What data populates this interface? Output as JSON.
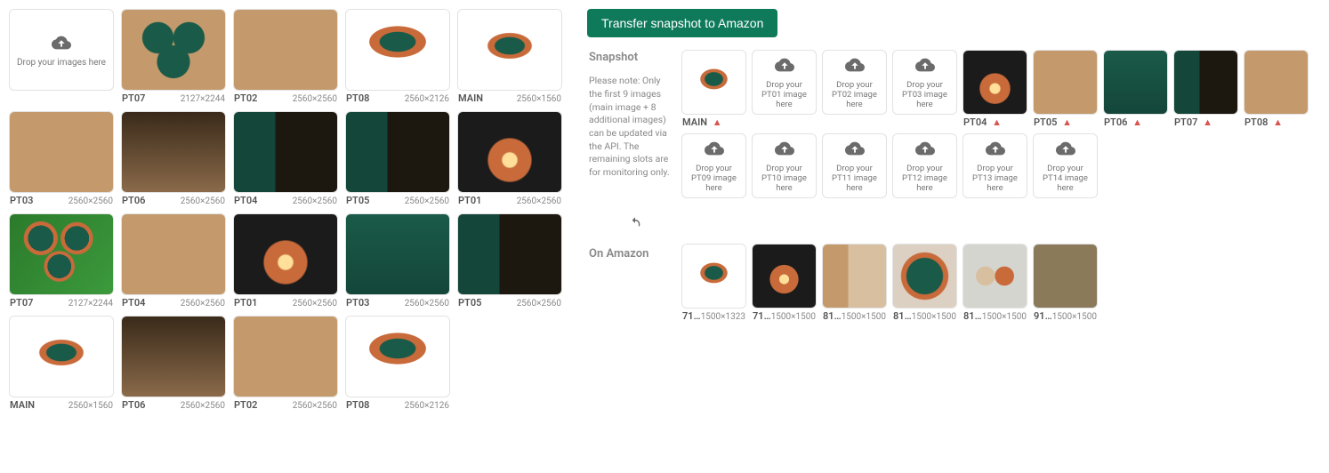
{
  "transfer_button": "Transfer snapshot to Amazon",
  "snapshot": {
    "title": "Snapshot",
    "note": "Please note: Only the first 9 images (main image + 8 additional images) can be updated via the API. The remaining slots are for monitoring only."
  },
  "left_drop_label": "Drop your images here",
  "left_images": [
    {
      "label": "PT07",
      "dim": "2127×2244",
      "variant": "green3"
    },
    {
      "label": "PT02",
      "dim": "2560×2560",
      "variant": "tan"
    },
    {
      "label": "PT08",
      "dim": "2560×2126",
      "variant": "bowl"
    },
    {
      "label": "MAIN",
      "dim": "2560×1560",
      "variant": "main"
    },
    {
      "label": "PT03",
      "dim": "2560×2560",
      "variant": "tan"
    },
    {
      "label": "PT06",
      "dim": "2560×2560",
      "variant": "people"
    },
    {
      "label": "PT04",
      "dim": "2560×2560",
      "variant": "night"
    },
    {
      "label": "PT05",
      "dim": "2560×2560",
      "variant": "night"
    },
    {
      "label": "PT01",
      "dim": "2560×2560",
      "variant": "dark"
    },
    {
      "label": "PT07",
      "dim": "2127×2244",
      "variant": "grass"
    },
    {
      "label": "PT04",
      "dim": "2560×2560",
      "variant": "tan"
    },
    {
      "label": "PT01",
      "dim": "2560×2560",
      "variant": "dark"
    },
    {
      "label": "PT03",
      "dim": "2560×2560",
      "variant": "teal"
    },
    {
      "label": "PT05",
      "dim": "2560×2560",
      "variant": "night"
    },
    {
      "label": "MAIN",
      "dim": "2560×1560",
      "variant": "main"
    },
    {
      "label": "PT06",
      "dim": "2560×2560",
      "variant": "people"
    },
    {
      "label": "PT02",
      "dim": "2560×2560",
      "variant": "tan"
    },
    {
      "label": "PT08",
      "dim": "2560×2126",
      "variant": "bowl"
    }
  ],
  "snapshot_slots": [
    {
      "label": "MAIN",
      "warn": true,
      "image": "main",
      "drop_text": ""
    },
    {
      "label": "",
      "drop_text": "Drop your PT01 image here"
    },
    {
      "label": "",
      "drop_text": "Drop your PT02 image here"
    },
    {
      "label": "",
      "drop_text": "Drop your PT03 image here"
    },
    {
      "label": "PT04",
      "warn": true,
      "image": "dark",
      "drop_text": ""
    },
    {
      "label": "PT05",
      "warn": true,
      "image": "tan",
      "drop_text": ""
    },
    {
      "label": "PT06",
      "warn": true,
      "image": "teal",
      "drop_text": ""
    },
    {
      "label": "PT07",
      "warn": true,
      "image": "night",
      "drop_text": ""
    },
    {
      "label": "PT08",
      "warn": true,
      "image": "tan",
      "drop_text": ""
    },
    {
      "label": "",
      "drop_text": "Drop your PT09 image here"
    },
    {
      "label": "",
      "drop_text": "Drop your PT10 image here"
    },
    {
      "label": "",
      "drop_text": "Drop your PT11 image here"
    },
    {
      "label": "",
      "drop_text": "Drop your PT12 image here"
    },
    {
      "label": "",
      "drop_text": "Drop your PT13 image here"
    },
    {
      "label": "",
      "drop_text": "Drop your PT14 image here"
    }
  ],
  "on_amazon": {
    "title": "On Amazon",
    "items": [
      {
        "label": "71…",
        "dim": "1500×1323",
        "variant": "main"
      },
      {
        "label": "71…",
        "dim": "1500×1500",
        "variant": "hand"
      },
      {
        "label": "81…",
        "dim": "1500×1500",
        "variant": "info"
      },
      {
        "label": "81…",
        "dim": "1500×1500",
        "variant": "top"
      },
      {
        "label": "81…",
        "dim": "1500×1500",
        "variant": "grey"
      },
      {
        "label": "91…",
        "dim": "1500×1500",
        "variant": "many"
      }
    ]
  }
}
